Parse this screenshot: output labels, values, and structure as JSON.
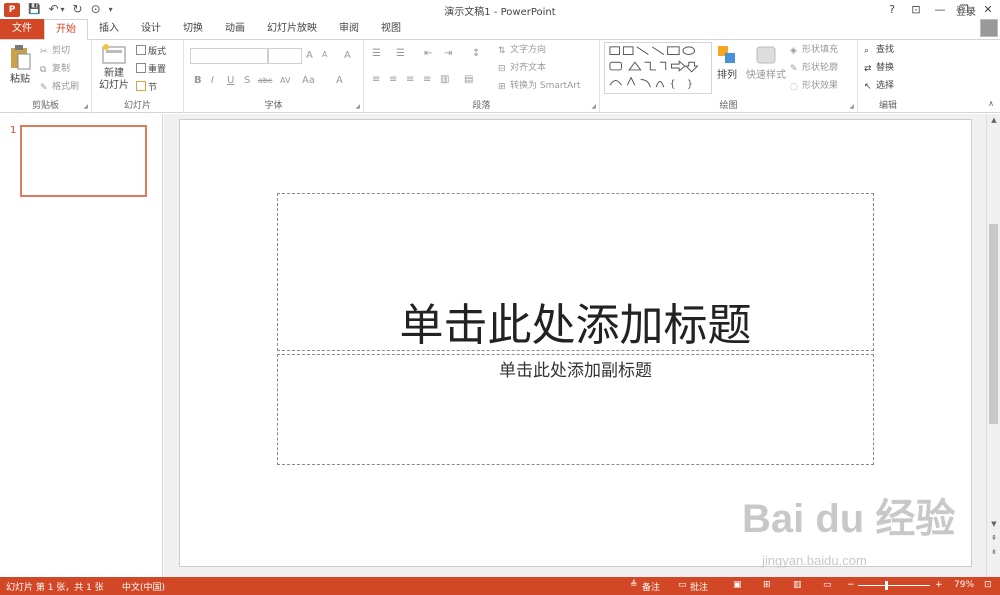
{
  "app": {
    "title": "演示文稿1 - PowerPoint",
    "logo_letter": "P",
    "login": "登录",
    "qat": {
      "save": "💾",
      "undo": "↶",
      "undo_dd": "▾",
      "redo": "↻",
      "present": "⊙",
      "custom": "▾"
    },
    "win": {
      "help": "?",
      "ribbon_display": "⊡",
      "minimize": "—",
      "restore": "❐",
      "close": "✕"
    }
  },
  "tabs": [
    "文件",
    "开始",
    "插入",
    "设计",
    "切换",
    "动画",
    "幻灯片放映",
    "审阅",
    "视图"
  ],
  "active_tab": "开始",
  "ribbon": {
    "clipboard": {
      "label": "剪贴板",
      "paste": "粘贴",
      "cut": "剪切",
      "copy": "复制",
      "format_painter": "格式刷"
    },
    "slides": {
      "label": "幻灯片",
      "new_slide_1": "新建",
      "new_slide_2": "幻灯片",
      "layout": "版式",
      "reset": "重置",
      "section": "节"
    },
    "font": {
      "label": "字体",
      "bold": "B",
      "italic": "I",
      "underline": "U",
      "shadow": "S",
      "strike": "abc",
      "spacing": "AV",
      "case": "Aa",
      "grow": "A",
      "shrink": "A",
      "clear": "A",
      "color": "A"
    },
    "paragraph": {
      "label": "段落",
      "text_direction": "文字方向",
      "align_text": "对齐文本",
      "smartart": "转换为 SmartArt"
    },
    "drawing": {
      "label": "绘图",
      "arrange": "排列",
      "quick_styles": "快速样式",
      "shape_fill": "形状填充",
      "shape_outline": "形状轮廓",
      "shape_effects": "形状效果"
    },
    "editing": {
      "label": "编辑",
      "find": "查找",
      "replace": "替换",
      "select": "选择"
    }
  },
  "slide_panel": {
    "number": "1"
  },
  "slide": {
    "title_placeholder": "单击此处添加标题",
    "subtitle_placeholder": "单击此处添加副标题"
  },
  "status": {
    "slide_info": "幻灯片 第 1 张，共 1 张",
    "language": "中文(中国)",
    "notes": "备注",
    "comments": "批注",
    "zoom": "79%",
    "zoom_level": 0.79
  },
  "watermark": {
    "brand": "Bai du 经验",
    "url": "jingyan.baidu.com"
  },
  "colors": {
    "accent": "#d24726"
  }
}
